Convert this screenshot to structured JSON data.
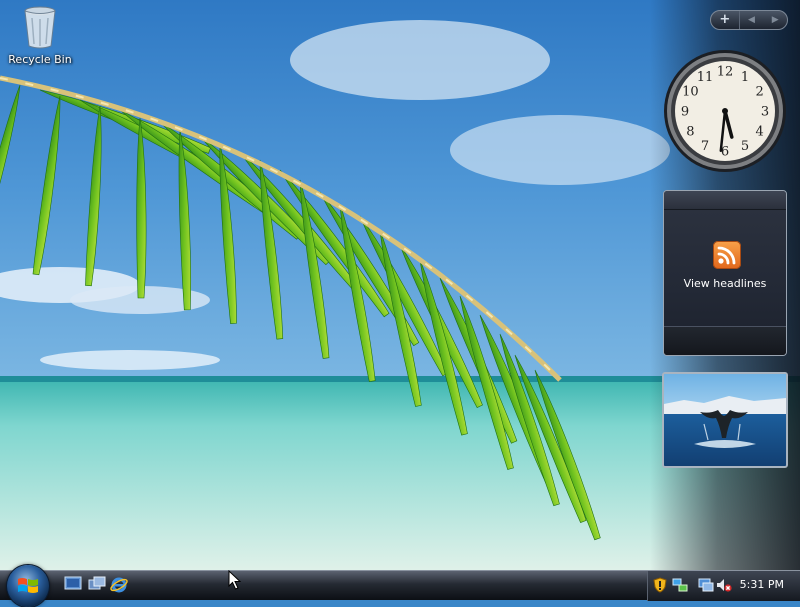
{
  "desktop": {
    "icons": [
      {
        "label": "Recycle Bin",
        "icon": "recycle-bin-icon"
      }
    ]
  },
  "sidebar": {
    "controls": {
      "add_label": "+",
      "prev_label": "◀",
      "next_label": "▶"
    },
    "clock": {
      "hour": 5,
      "minute": 31
    },
    "feed": {
      "label": "View headlines",
      "icon": "rss-feed-icon"
    },
    "slideshow": {
      "icon": "whale-tail-photo"
    }
  },
  "taskbar": {
    "start_icon": "windows-logo-icon",
    "quick_launch": [
      "show-desktop-icon",
      "switch-windows-icon",
      "internet-explorer-icon"
    ],
    "tray_icons": [
      "security-shield-icon",
      "network-icon",
      "volume-muted-icon"
    ],
    "clock": "5:31 PM"
  },
  "colors": {
    "feed_orange": "#f0842c",
    "taskbar_dark": "#1a1e26"
  }
}
